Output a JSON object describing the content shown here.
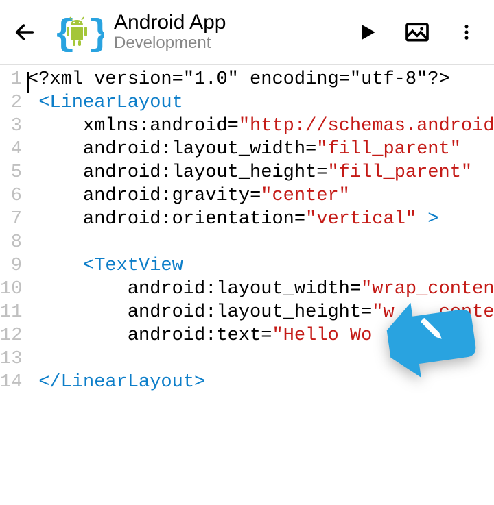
{
  "header": {
    "title": "Android App",
    "subtitle": "Development"
  },
  "code": {
    "lines": [
      {
        "n": "1",
        "indent": 0,
        "segments": [
          {
            "t": "<?xml version=\"1.0\" encoding=\"utf-8\"?>",
            "c": "punct"
          }
        ],
        "caret": true
      },
      {
        "n": "2",
        "indent": 1,
        "segments": [
          {
            "t": "<LinearLayout",
            "c": "tag"
          }
        ]
      },
      {
        "n": "3",
        "indent": 4,
        "segments": [
          {
            "t": "xmlns:android",
            "c": "attr"
          },
          {
            "t": "=",
            "c": "punct"
          },
          {
            "t": "\"http://schemas.android.",
            "c": "string"
          }
        ]
      },
      {
        "n": "4",
        "indent": 4,
        "segments": [
          {
            "t": "android:layout_width",
            "c": "attr"
          },
          {
            "t": "=",
            "c": "punct"
          },
          {
            "t": "\"fill_parent\"",
            "c": "string"
          }
        ]
      },
      {
        "n": "5",
        "indent": 4,
        "segments": [
          {
            "t": "android:layout_height",
            "c": "attr"
          },
          {
            "t": "=",
            "c": "punct"
          },
          {
            "t": "\"fill_parent\"",
            "c": "string"
          }
        ]
      },
      {
        "n": "6",
        "indent": 4,
        "segments": [
          {
            "t": "android:gravity",
            "c": "attr"
          },
          {
            "t": "=",
            "c": "punct"
          },
          {
            "t": "\"center\"",
            "c": "string"
          }
        ]
      },
      {
        "n": "7",
        "indent": 4,
        "segments": [
          {
            "t": "android:orientation",
            "c": "attr"
          },
          {
            "t": "=",
            "c": "punct"
          },
          {
            "t": "\"vertical\"",
            "c": "string"
          },
          {
            "t": " >",
            "c": "tag"
          }
        ]
      },
      {
        "n": "8",
        "indent": 0,
        "segments": []
      },
      {
        "n": "9",
        "indent": 4,
        "segments": [
          {
            "t": "<TextView",
            "c": "tag"
          }
        ]
      },
      {
        "n": "10",
        "indent": 7,
        "segments": [
          {
            "t": "android:layout_width",
            "c": "attr"
          },
          {
            "t": "=",
            "c": "punct"
          },
          {
            "t": "\"wrap_content",
            "c": "string"
          }
        ]
      },
      {
        "n": "11",
        "indent": 7,
        "segments": [
          {
            "t": "android:layout_height",
            "c": "attr"
          },
          {
            "t": "=",
            "c": "punct"
          },
          {
            "t": "\"w",
            "c": "string"
          },
          {
            "t": "    ",
            "c": "punct"
          },
          {
            "t": "conten",
            "c": "string"
          }
        ]
      },
      {
        "n": "12",
        "indent": 7,
        "segments": [
          {
            "t": "android:text",
            "c": "attr"
          },
          {
            "t": "=",
            "c": "punct"
          },
          {
            "t": "\"Hello Wo",
            "c": "string"
          }
        ]
      },
      {
        "n": "13",
        "indent": 0,
        "segments": []
      },
      {
        "n": "14",
        "indent": 1,
        "segments": [
          {
            "t": "</LinearLayout>",
            "c": "tag"
          }
        ]
      }
    ]
  },
  "colors": {
    "accent": "#29a3e0",
    "tag": "#0d7ec9",
    "string": "#c41a16"
  }
}
